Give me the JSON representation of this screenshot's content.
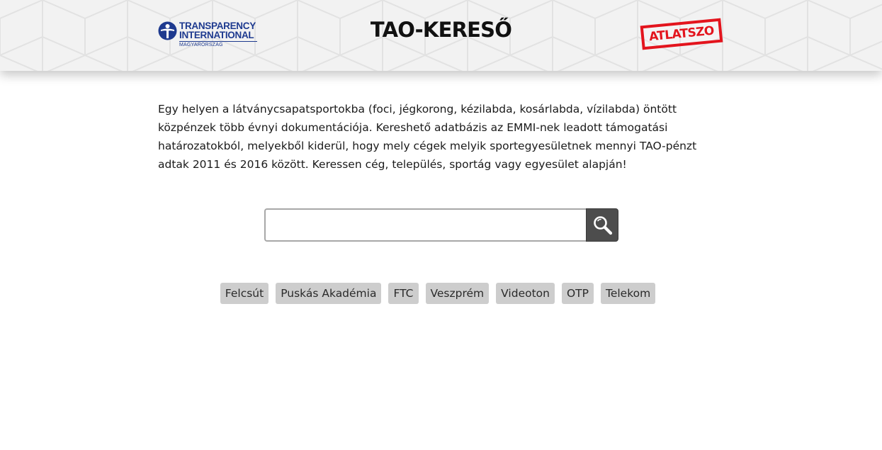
{
  "header": {
    "ti_logo": {
      "line1": "TRANSPARENCY",
      "line2": "INTERNATIONAL",
      "sub": "MAGYARORSZÁG",
      "color": "#1e3a8f"
    },
    "title": "TAO-KERESŐ",
    "atlatszo_logo": {
      "text": "ATLATSZO",
      "color": "#e3141d"
    }
  },
  "intro": {
    "text": "Egy helyen a látványcsapatsportokba (foci, jégkorong, kézilabda, kosárlabda, vízilabda) öntött közpénzek több évnyi dokumentációja. Kereshető adatbázis az EMMI-nek leadott támogatási határozatokból, melyekből kiderül, hogy mely cégek melyik sportegyesületnek mennyi TAO-pénzt adtak 2011 és 2016 között. Keressen cég, település, sportág vagy egyesület alapján!"
  },
  "search": {
    "value": "",
    "placeholder": "",
    "button_icon": "search-icon",
    "button_color": "#4d4d4d"
  },
  "quick_tags": [
    "Felcsút",
    "Puskás Akadémia",
    "FTC",
    "Veszprém",
    "Videoton",
    "OTP",
    "Telekom"
  ]
}
